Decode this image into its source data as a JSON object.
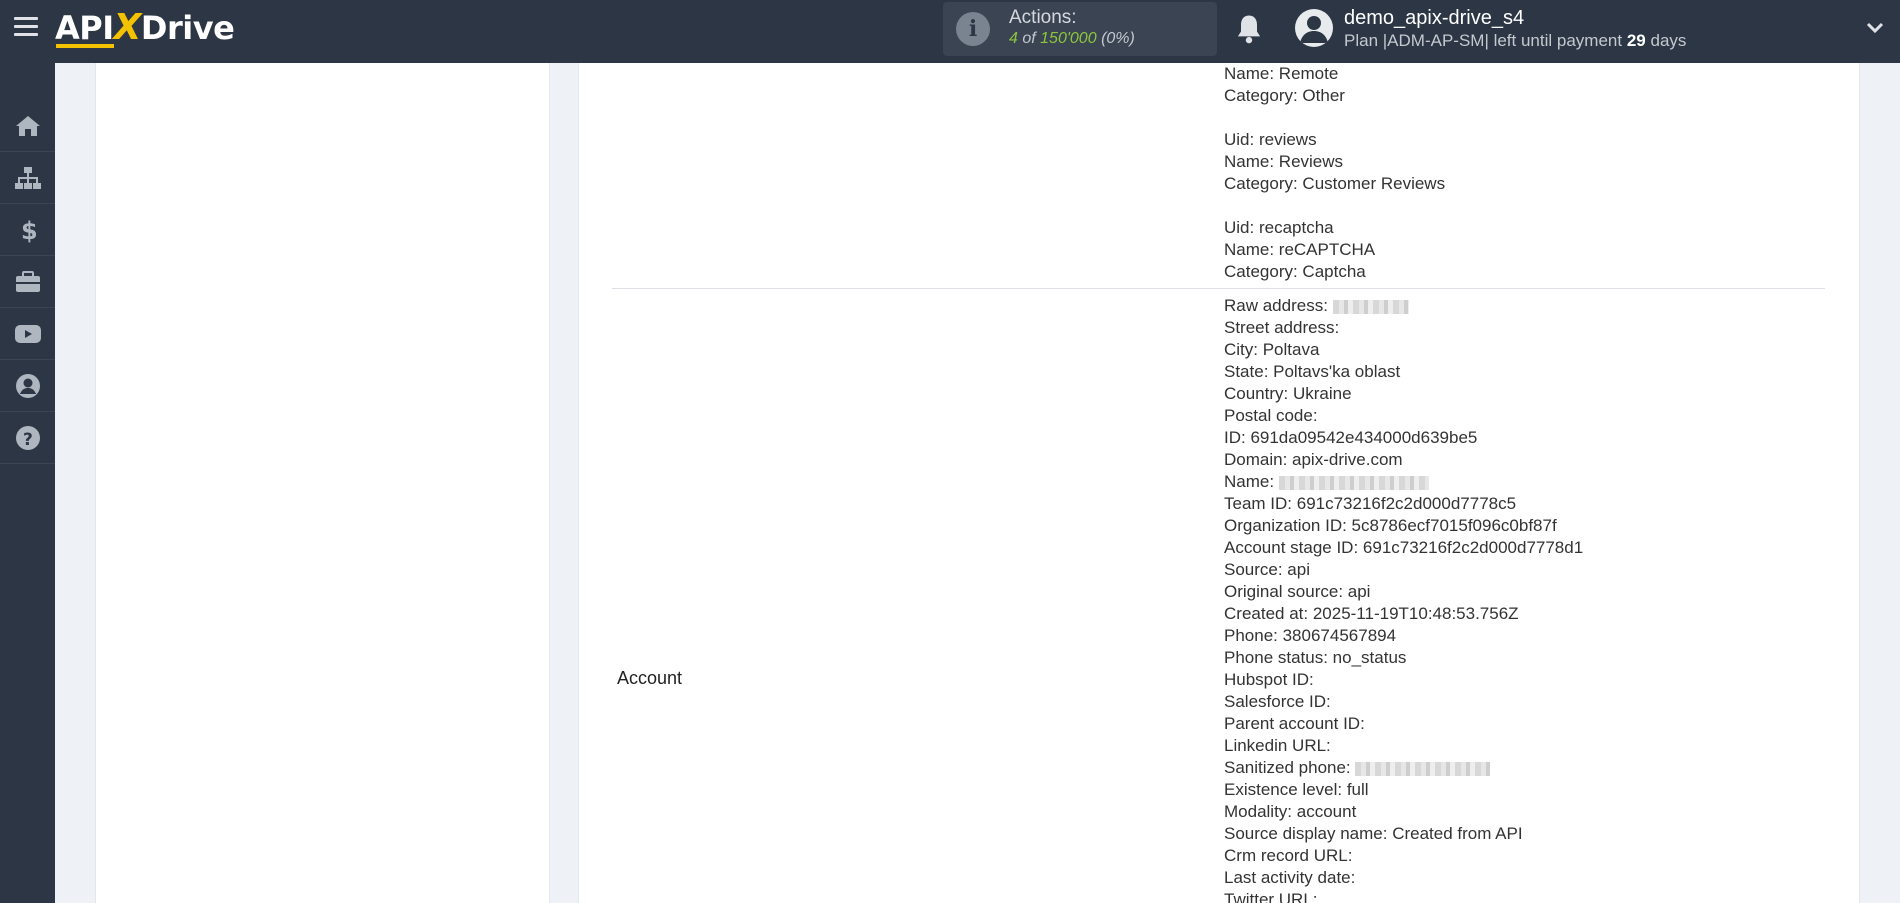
{
  "header": {
    "logo": {
      "a": "API",
      "x": "X",
      "b": "Drive"
    },
    "actions_label": "Actions:",
    "actions_used": "4",
    "actions_of": "of",
    "actions_total": "150'000",
    "actions_percent": "(0%)",
    "user_name": "demo_apix-drive_s4",
    "plan_prefix": "Plan |ADM-AP-SM| left until payment",
    "plan_days": "29",
    "plan_suffix": "days"
  },
  "sidebar": {
    "items": [
      "home-icon",
      "sitemap-icon",
      "dollar-icon",
      "briefcase-icon",
      "youtube-icon",
      "user-circle-icon",
      "help-icon"
    ]
  },
  "categories_block": [
    "Name: Remote",
    "Category: Other",
    "",
    "Uid: reviews",
    "Name: Reviews",
    "Category: Customer Reviews",
    "",
    "Uid: recaptcha",
    "Name: reCAPTCHA",
    "Category: Captcha"
  ],
  "account": {
    "label": "Account",
    "fields": [
      "Raw address:",
      "Street address:",
      "City: Poltava",
      "State: Poltavs'ka oblast",
      "Country: Ukraine",
      "Postal code:",
      "ID: 691da09542e434000d639be5",
      "Domain: apix-drive.com",
      "Name:",
      "Team ID: 691c73216f2c2d000d7778c5",
      "Organization ID: 5c8786ecf7015f096c0bf87f",
      "Account stage ID: 691c73216f2c2d000d7778d1",
      "Source: api",
      "Original source: api",
      "Created at: 2025-11-19T10:48:53.756Z",
      "Phone: 380674567894",
      "Phone status: no_status",
      "Hubspot ID:",
      "Salesforce ID:",
      "Parent account ID:",
      "Linkedin URL:",
      "Sanitized phone:",
      "Existence level: full",
      "Modality: account",
      "Source display name: Created from API",
      "Crm record URL:",
      "Last activity date:",
      "Twitter URL:"
    ]
  }
}
